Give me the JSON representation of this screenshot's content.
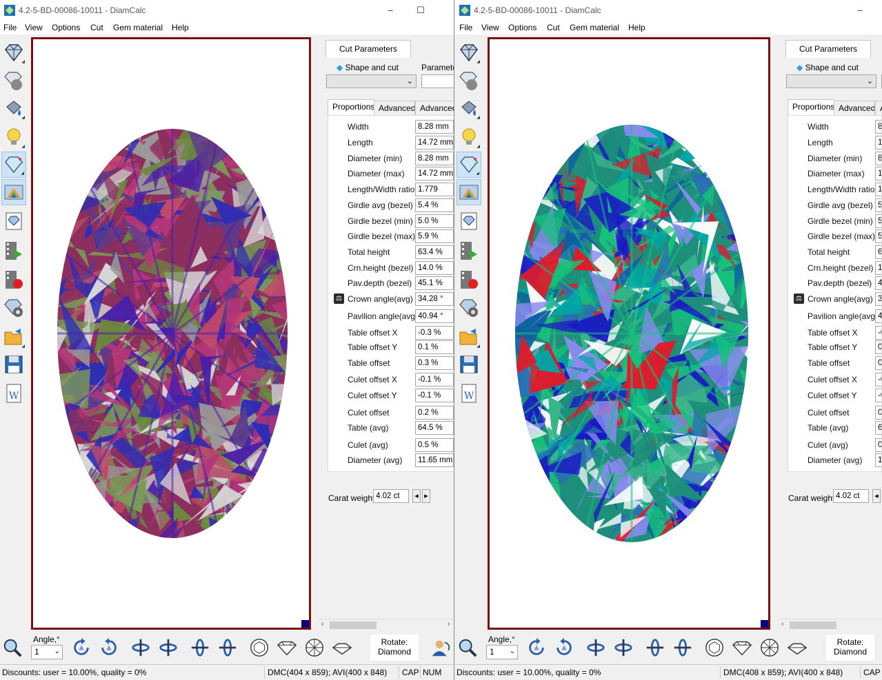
{
  "window": {
    "title": "4.2-5-BD-00086-10011 - DiamCalc",
    "title_left": "4.2-5-BD-00086-10011 - DiamCalc"
  },
  "menu": [
    "File",
    "View",
    "Options",
    "Cut",
    "Gem material",
    "Help"
  ],
  "left_toolbar_icons": [
    "diamond-view-icon",
    "diamond-sphere-icon",
    "paint-bucket-icon",
    "light-bulb-icon",
    "sparkle-diamond-icon",
    "spectrum-icon",
    "photo-icon",
    "video-play-icon",
    "video-record-icon",
    "diamond-gear-icon",
    "open-folder-icon",
    "save-disk-icon",
    "word-report-icon"
  ],
  "panel": {
    "tab_cut_parameters": "Cut Parameters",
    "shape_and_cut": "Shape and cut",
    "parameters": "Parameter",
    "subtabs": [
      "Proportions",
      "Advanced",
      "Advanced"
    ],
    "carat_weight_label": "Carat weight",
    "carat_weight_value": "4.02 ct"
  },
  "proportions": [
    {
      "label": "Width",
      "value": "8.28 mm"
    },
    {
      "label": "Length",
      "value": "14.72 mm"
    },
    {
      "label": "Diameter (min)",
      "value": "8.28 mm"
    },
    {
      "label": "Diameter (max)",
      "value": "14.72 mm"
    },
    {
      "label": "Length/Width ratio",
      "value": "1.779"
    },
    {
      "label": "Girdle avg (bezel)",
      "value": "5.4 %"
    },
    {
      "label": "Girdle bezel (min)",
      "value": "5.0 %"
    },
    {
      "label": "Girdle bezel (max)",
      "value": "5.9 %"
    },
    {
      "label": "Total height",
      "value": "63.4 %"
    },
    {
      "label": "Crn.height (bezel)",
      "value": "14.0 %"
    },
    {
      "label": "Pav.depth (bezel)",
      "value": "45.1 %"
    },
    {
      "label": "Crown angle(avg)",
      "value": "34.28 °"
    },
    {
      "label": "Pavilion angle(avg)",
      "value": "40.94 °"
    },
    {
      "label": "Table offset X",
      "value": "-0.3 %"
    },
    {
      "label": "Table offset Y",
      "value": "0.1 %"
    },
    {
      "label": "Table offset",
      "value": "0.3 %"
    },
    {
      "label": "Culet offset X",
      "value": "-0.1 %"
    },
    {
      "label": "Culet offset Y",
      "value": "-0.1 %"
    },
    {
      "label": "Culet offset",
      "value": "0.2 %"
    },
    {
      "label": "Table (avg)",
      "value": "64.5 %"
    },
    {
      "label": "Culet (avg)",
      "value": "0.5 %"
    },
    {
      "label": "Diameter (avg)",
      "value": "11.65 mm"
    }
  ],
  "bottom": {
    "angle_label": "Angle,°",
    "angle_value": "1",
    "rotate_label": "Rotate:",
    "rotate_value": "Diamond"
  },
  "status_left": {
    "discounts": "Discounts: user = 10.00%, quality = 0%",
    "dmc": "DMC(404 x 859); AVI(400 x 848)",
    "cap": "CAP",
    "num": "NUM"
  },
  "status_right": {
    "discounts": "Discounts: user = 10.00%, quality = 0%",
    "dmc": "DMC(408 x 859); AVI(400 x 848)",
    "cap": "CAP"
  },
  "colors": {
    "viewport_border": "#7a0f0f",
    "accent": "#00008b",
    "left_gem_palette": [
      "#8c2f5e",
      "#b5367a",
      "#6b8a3f",
      "#4b1fa8",
      "#9a9a9a",
      "#d8d8d8",
      "#2d2db5",
      "#7a9a5a",
      "#c24a6a",
      "#5a3c8c"
    ],
    "right_gem_palette": [
      "#1e8f7a",
      "#2a6fb5",
      "#00a6a6",
      "#16c27a",
      "#ffffff",
      "#1a1ac2",
      "#e01a2a",
      "#8a8af0",
      "#0d5fa0",
      "#3ab58a"
    ]
  }
}
